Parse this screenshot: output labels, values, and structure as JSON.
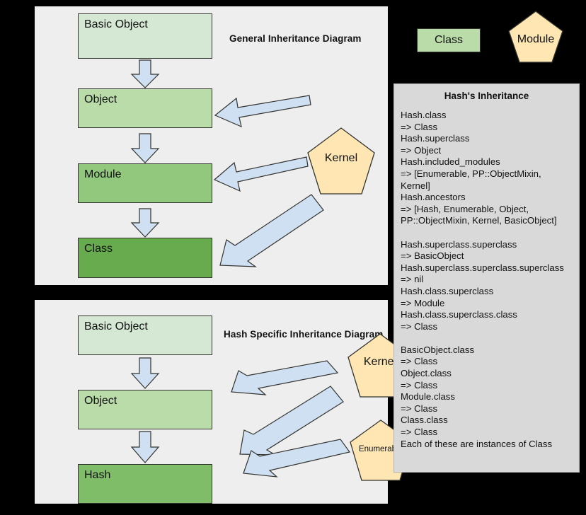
{
  "legend": {
    "class_shape_label": "Class",
    "module_shape_label": "Module"
  },
  "general_diagram": {
    "title": "General Inheritance Diagram",
    "boxes": [
      {
        "label": "Basic Object",
        "color": "#d5e8d4"
      },
      {
        "label": "Object",
        "color": "#b9dca8"
      },
      {
        "label": "Module",
        "color": "#92c87e"
      },
      {
        "label": "Class",
        "color": "#67ab4e"
      }
    ],
    "modules": [
      {
        "label": "Kernel",
        "color": "#ffe6b3"
      }
    ],
    "down_arrow_count": 3,
    "module_arrow_targets": [
      "Object",
      "Module",
      "Class"
    ]
  },
  "hash_diagram": {
    "title": "Hash Specific Inheritance Diagram",
    "boxes": [
      {
        "label": "Basic Object",
        "color": "#d5e8d4"
      },
      {
        "label": "Object",
        "color": "#b9dca8"
      },
      {
        "label": "Hash",
        "color": "#7fbd69"
      }
    ],
    "modules": [
      {
        "label": "Kernel",
        "color": "#ffe6b3"
      },
      {
        "label": "Enumerable",
        "color": "#ffe6b3"
      }
    ],
    "down_arrow_count": 2,
    "module_arrow_count": 3
  },
  "text_panel": {
    "title": "Hash's Inheritance",
    "body": "Hash.class\n=> Class\nHash.superclass\n=> Object\nHash.included_modules\n=> [Enumerable, PP::ObjectMixin,\nKernel]\nHash.ancestors\n=> [Hash, Enumerable, Object,\nPP::ObjectMixin, Kernel, BasicObject]\n\nHash.superclass.superclass\n=> BasicObject\nHash.superclass.superclass.superclass\n=> nil\nHash.class.superclass\n=> Module\nHash.class.superclass.class\n=> Class\n\nBasicObject.class\n=> Class\nObject.class\n=> Class\nModule.class\n=> Class\nClass.class\n=> Class\nEach of these are instances of Class"
  },
  "colors": {
    "arrow_fill": "#cfe0f3",
    "arrow_stroke": "#33332f",
    "pentagon_fill": "#ffe6b3",
    "pentagon_stroke": "#33332f",
    "panel_bg": "#eeeeee",
    "text_panel_bg": "#d9d9d9",
    "page_bg": "#000000"
  }
}
